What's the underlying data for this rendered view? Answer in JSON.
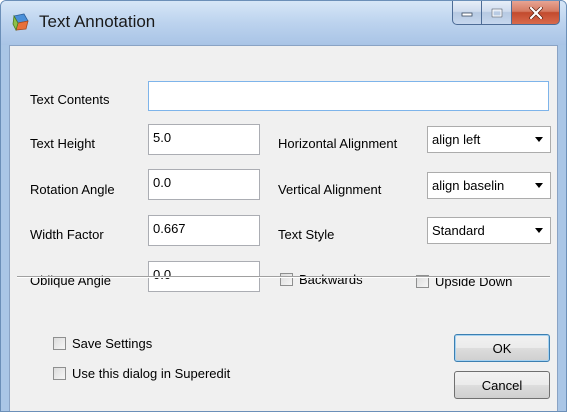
{
  "window": {
    "title": "Text Annotation",
    "icon": "text-annotation-app-icon",
    "caption_buttons": [
      "minimize-icon",
      "maximize-icon",
      "close-icon"
    ]
  },
  "fields": {
    "text_contents": {
      "label": "Text Contents",
      "value": ""
    },
    "text_height": {
      "label": "Text Height",
      "value": "5.0"
    },
    "rotation_angle": {
      "label": "Rotation Angle",
      "value": "0.0"
    },
    "width_factor": {
      "label": "Width Factor",
      "value": "0.667"
    },
    "oblique_angle": {
      "label": "Oblique Angle",
      "value": "0.0"
    }
  },
  "combos": {
    "horizontal_alignment": {
      "label": "Horizontal Alignment",
      "value": "align left"
    },
    "vertical_alignment": {
      "label": "Vertical Alignment",
      "value": "align baselin"
    },
    "text_style": {
      "label": "Text Style",
      "value": "Standard"
    }
  },
  "checkboxes": {
    "backwards": {
      "label": "Backwards",
      "checked": false
    },
    "upside_down": {
      "label": "Upside Down",
      "checked": false
    },
    "save_settings": {
      "label": "Save Settings",
      "checked": false
    },
    "use_in_superedit": {
      "label": "Use this dialog in Superedit",
      "checked": false
    }
  },
  "buttons": {
    "ok": "OK",
    "cancel": "Cancel"
  },
  "colors": {
    "title_bar": "#bcd3ee",
    "dialog_bg": "#f0f0f0",
    "close_button": "#c24a2e",
    "focus_border": "#7eb4ea"
  }
}
